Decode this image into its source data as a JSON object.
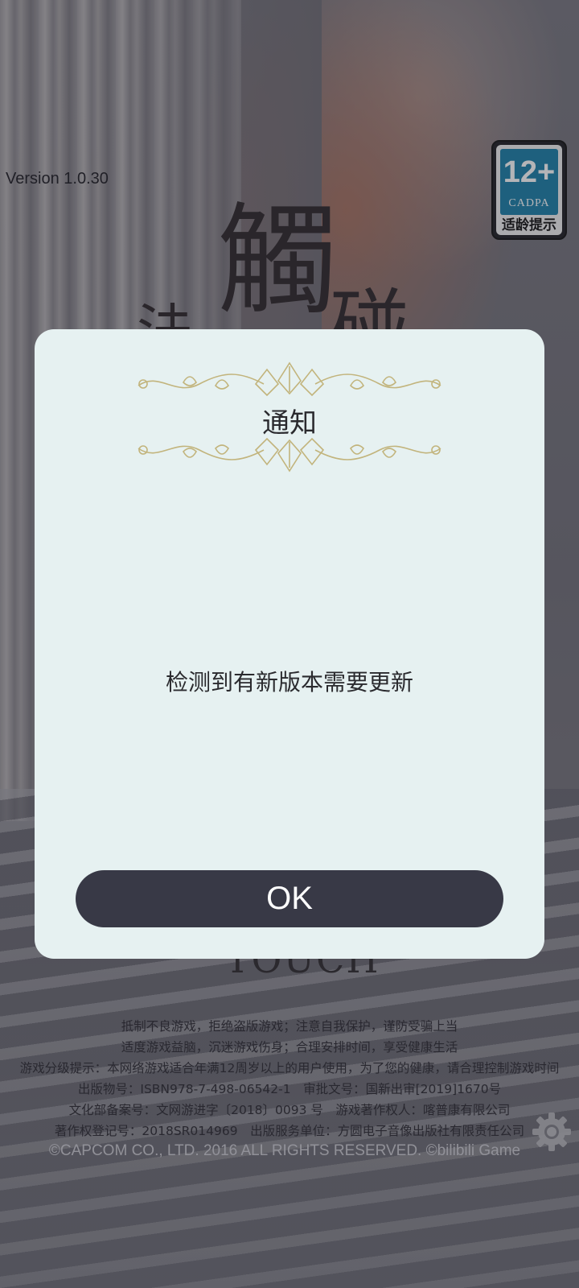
{
  "app": {
    "version_label": "Version 1.0.30",
    "logo_chars": [
      "觸",
      "碰",
      "法"
    ],
    "touch_label": "TOUCH"
  },
  "age_rating": {
    "age": "12+",
    "org": "CADPA",
    "tip": "适龄提示",
    "color": "#1a7fa8"
  },
  "footer": {
    "lines": [
      "抵制不良游戏，拒绝盗版游戏；注意自我保护，谨防受骗上当",
      "适度游戏益脑，沉迷游戏伤身；合理安排时间，享受健康生活",
      "游戏分级提示：本网络游戏适合年满12周岁以上的用户使用，为了您的健康，请合理控制游戏时间",
      "出版物号：ISBN978-7-498-06542-1　审批文号：国新出审[2019]1670号",
      "文化部备案号：文网游进字〔2018〕0093 号　游戏著作权人：喀普康有限公司",
      "著作权登记号：2018SR014969　出版服务单位：方圆电子音像出版社有限责任公司"
    ],
    "copyright": "©CAPCOM CO., LTD. 2016 ALL RIGHTS RESERVED. ©bilibili Game",
    "settings_icon": "gear-icon"
  },
  "dialog": {
    "title": "通知",
    "message": "检测到有新版本需要更新",
    "ok_label": "OK",
    "button_color": "#383946",
    "background_color": "#e6f1f1"
  }
}
